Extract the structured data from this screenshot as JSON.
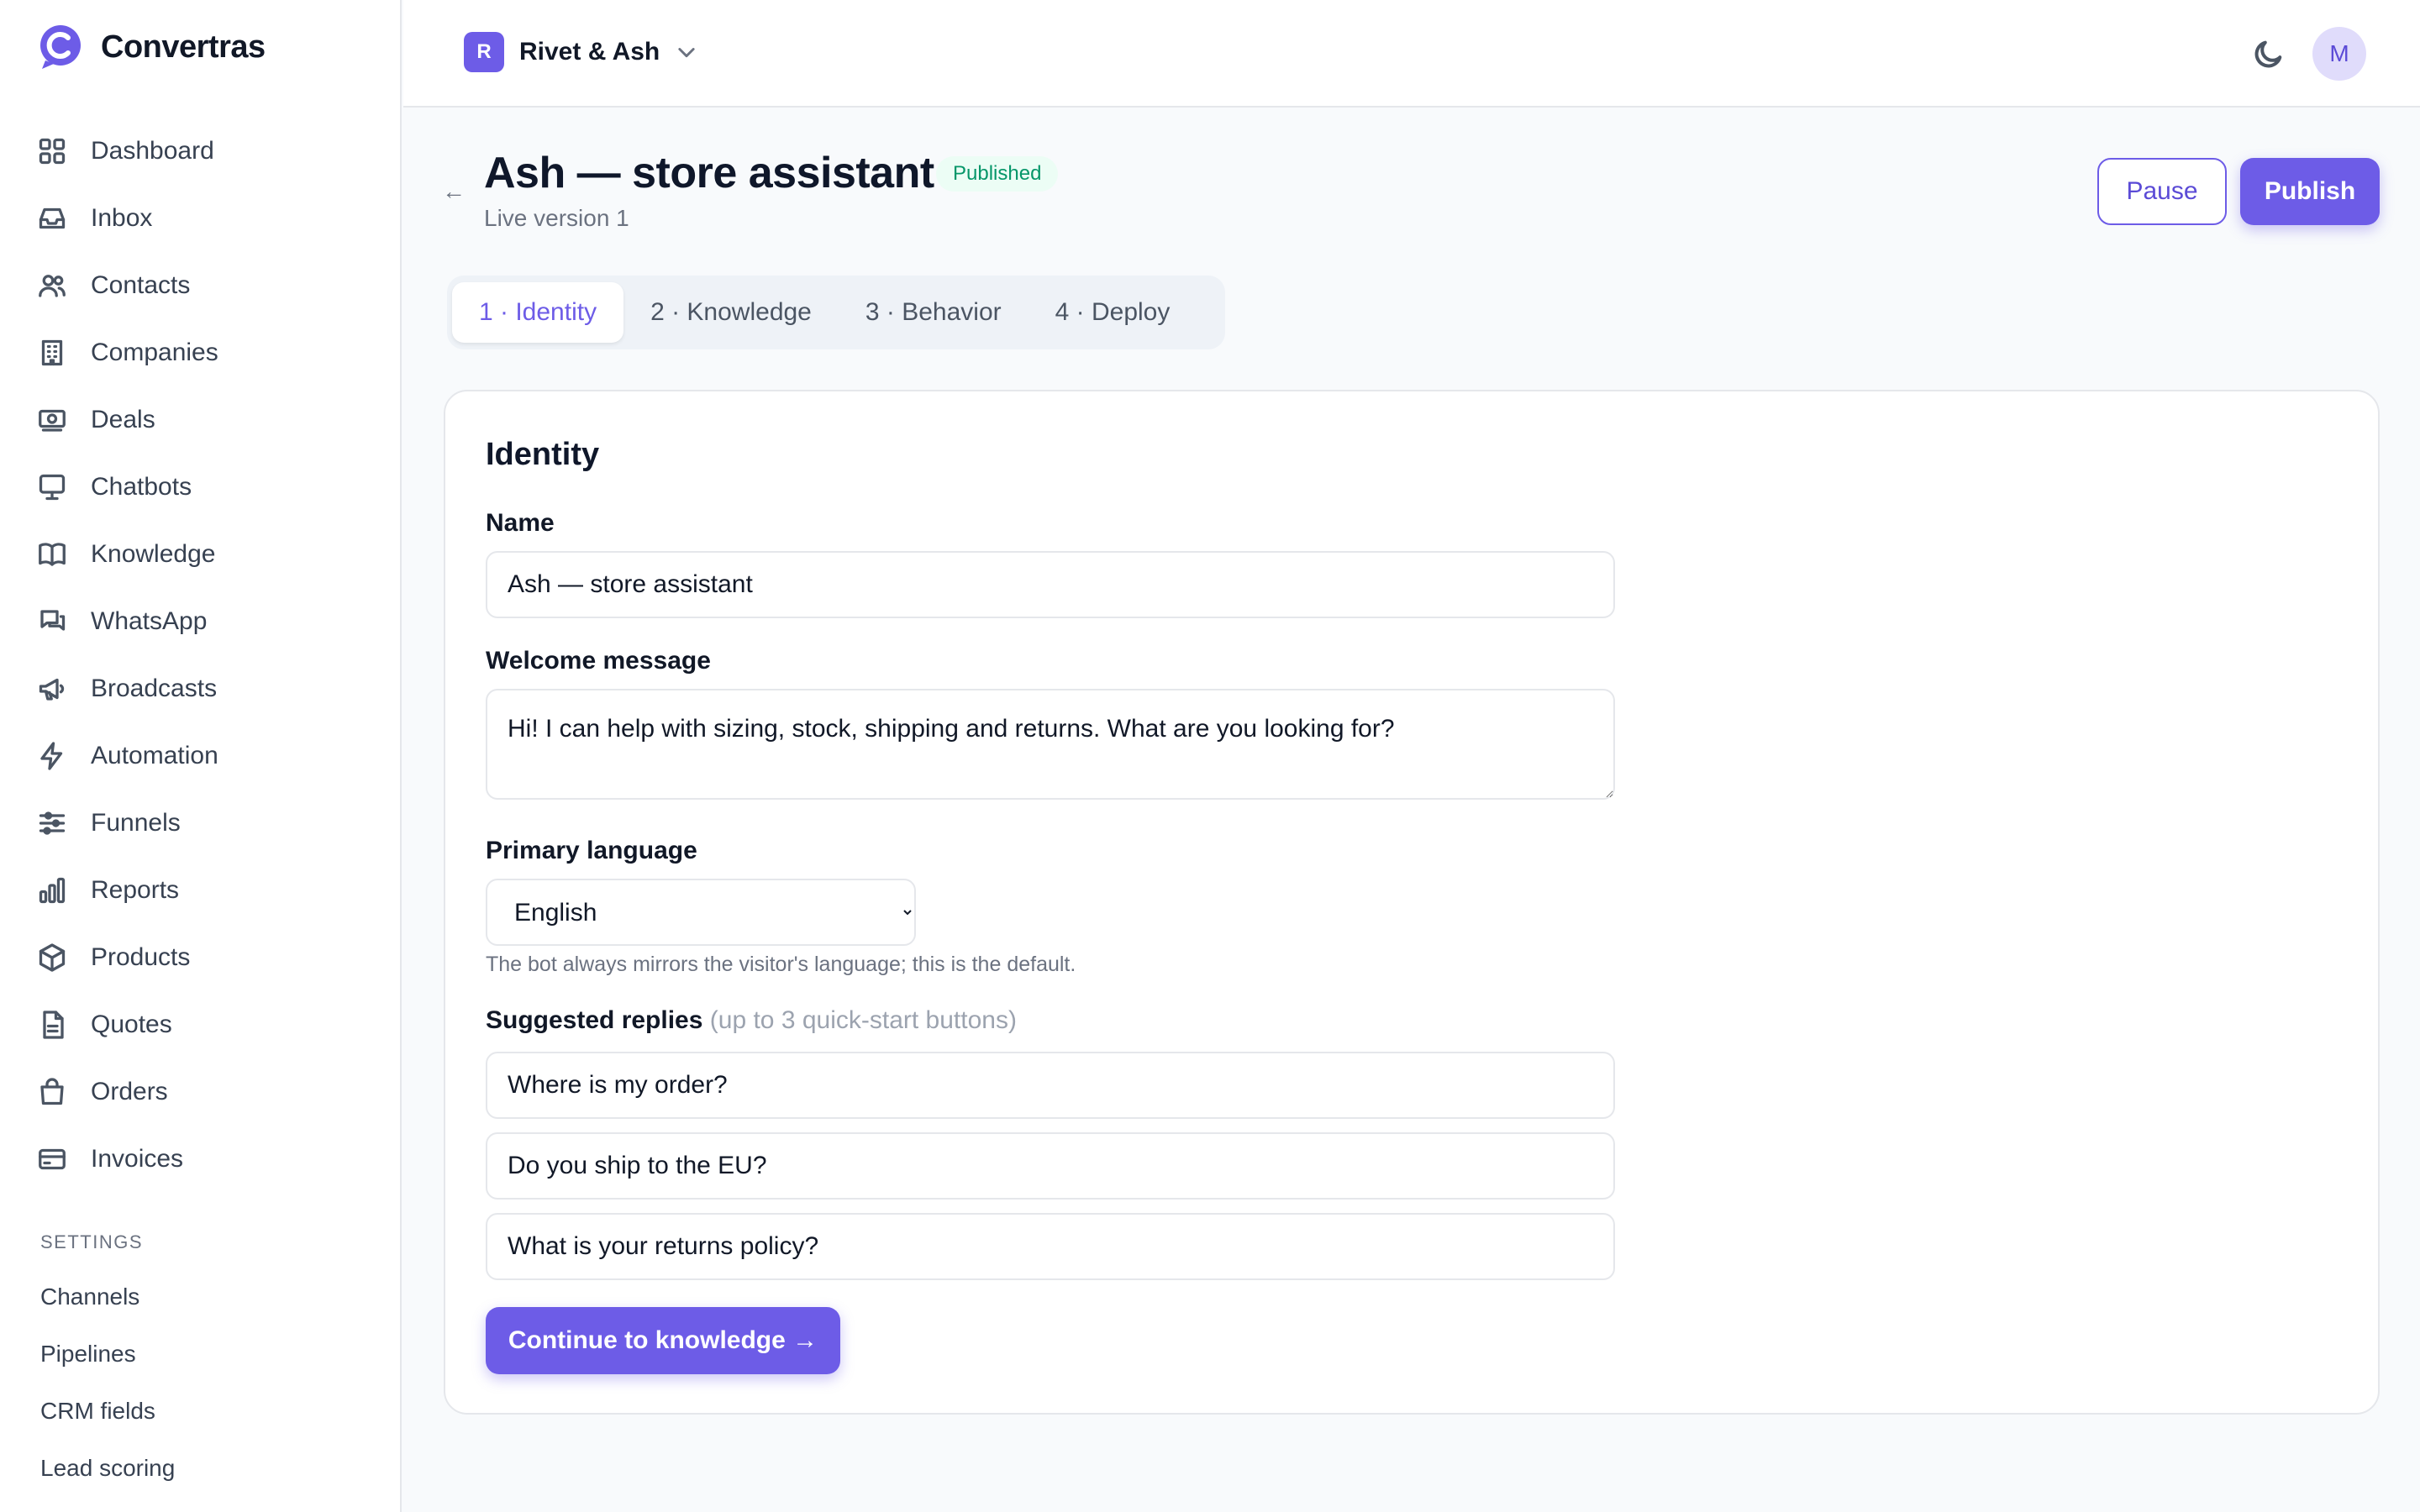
{
  "brand": {
    "name": "Convertras",
    "logo_icon": "c-logo-icon",
    "accent": "#6d5ce7"
  },
  "sidebar": {
    "items": [
      {
        "label": "Dashboard",
        "icon": "grid-icon"
      },
      {
        "label": "Inbox",
        "icon": "inbox-icon"
      },
      {
        "label": "Contacts",
        "icon": "users-icon"
      },
      {
        "label": "Companies",
        "icon": "building-icon"
      },
      {
        "label": "Deals",
        "icon": "money-icon"
      },
      {
        "label": "Chatbots",
        "icon": "monitor-icon"
      },
      {
        "label": "Knowledge",
        "icon": "book-icon"
      },
      {
        "label": "WhatsApp",
        "icon": "chat-icon"
      },
      {
        "label": "Broadcasts",
        "icon": "megaphone-icon"
      },
      {
        "label": "Automation",
        "icon": "bolt-icon"
      },
      {
        "label": "Funnels",
        "icon": "sliders-icon"
      },
      {
        "label": "Reports",
        "icon": "bar-chart-icon"
      },
      {
        "label": "Products",
        "icon": "box-icon"
      },
      {
        "label": "Quotes",
        "icon": "file-icon"
      },
      {
        "label": "Orders",
        "icon": "bag-icon"
      },
      {
        "label": "Invoices",
        "icon": "card-icon"
      }
    ],
    "settings_heading": "SETTINGS",
    "settings_items": [
      "Channels",
      "Pipelines",
      "CRM fields",
      "Lead scoring"
    ]
  },
  "topbar": {
    "workspace_initial": "R",
    "workspace_name": "Rivet & Ash",
    "avatar_initial": "M"
  },
  "header": {
    "back": "←",
    "title": "Ash — store assistant",
    "status": "Published",
    "subtitle": "Live version 1",
    "pause_label": "Pause",
    "publish_label": "Publish"
  },
  "tabs": [
    {
      "label": "1 · Identity",
      "active": true
    },
    {
      "label": "2 · Knowledge",
      "active": false
    },
    {
      "label": "3 · Behavior",
      "active": false
    },
    {
      "label": "4 · Deploy",
      "active": false
    }
  ],
  "form": {
    "title": "Identity",
    "name_label": "Name",
    "name_value": "Ash — store assistant",
    "welcome_label": "Welcome message",
    "welcome_value": "Hi! I can help with sizing, stock, shipping and returns. What are you looking for?",
    "language_label": "Primary language",
    "language_value": "English",
    "language_helper": "The bot always mirrors the visitor's language; this is the default.",
    "replies_label": "Suggested replies",
    "replies_hint": "(up to 3 quick-start buttons)",
    "replies": [
      "Where is my order?",
      "Do you ship to the EU?",
      "What is your returns policy?"
    ],
    "continue_label": "Continue to knowledge →"
  }
}
